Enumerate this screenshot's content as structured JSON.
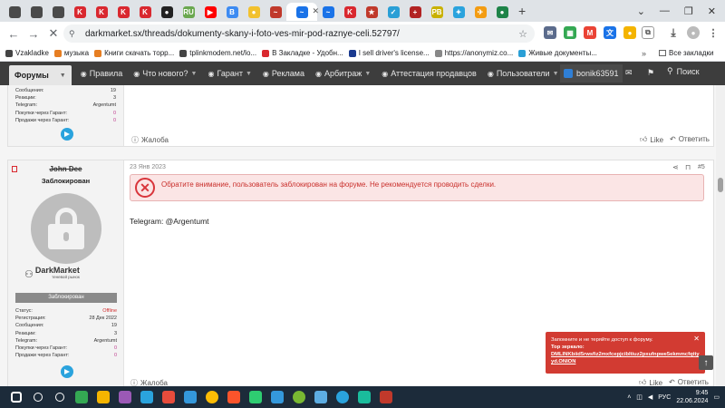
{
  "tabs": [
    {
      "icon": "ring-icon",
      "color": "#4a4a4a",
      "text": ""
    },
    {
      "icon": "ring-icon",
      "color": "#4a4a4a",
      "text": ""
    },
    {
      "icon": "ring-icon",
      "color": "#4a4a4a",
      "text": ""
    },
    {
      "icon": "k-icon",
      "color": "#d9282f",
      "text": "K"
    },
    {
      "icon": "k-icon",
      "color": "#d9282f",
      "text": "K"
    },
    {
      "icon": "k-icon",
      "color": "#d9282f",
      "text": "K"
    },
    {
      "icon": "k-icon",
      "color": "#d9282f",
      "text": "K"
    },
    {
      "icon": "user-icon",
      "color": "#222",
      "text": "●"
    },
    {
      "icon": "ru-icon",
      "color": "#6aa84f",
      "text": "RU"
    },
    {
      "icon": "youtube-icon",
      "color": "#ff0000",
      "text": "▶"
    },
    {
      "icon": "bitcoin-icon",
      "color": "#3d8bf2",
      "text": "B"
    },
    {
      "icon": "coin-icon",
      "color": "#f2c12e",
      "text": "●"
    },
    {
      "icon": "bird-icon",
      "color": "#c0392b",
      "text": "~"
    },
    {
      "icon": "bird-icon",
      "color": "#1a73e8",
      "text": "~"
    },
    {
      "icon": "bird-icon",
      "color": "#1a73e8",
      "text": "~"
    },
    {
      "icon": "k-icon",
      "color": "#d9282f",
      "text": "K"
    },
    {
      "icon": "star-icon",
      "color": "#c0392b",
      "text": "★"
    },
    {
      "icon": "flag-icon",
      "color": "#2a9fd6",
      "text": "✓"
    },
    {
      "icon": "plus-icon",
      "color": "#b22222",
      "text": "+"
    },
    {
      "icon": "pb-icon",
      "color": "#c9b100",
      "text": "PB"
    },
    {
      "icon": "puzzle-icon",
      "color": "#2aa3dd",
      "text": "✦"
    },
    {
      "icon": "plane-icon",
      "color": "#f39c12",
      "text": "✈"
    },
    {
      "icon": "dot-icon",
      "color": "#1e8449",
      "text": "●"
    }
  ],
  "browser": {
    "url": "darkmarket.sx/threads/dokumenty-skany-i-foto-ves-mir-pod-raznye-celi.52797/",
    "bookmarks": [
      {
        "label": "Vzakladke",
        "color": "#444"
      },
      {
        "label": "музыка",
        "color": "#e67e22"
      },
      {
        "label": "Книги скачать торр...",
        "color": "#e67e22"
      },
      {
        "label": "tplinkmodem.net/lo...",
        "color": "#444"
      },
      {
        "label": "В Закладке - Удобн...",
        "color": "#d9282f"
      },
      {
        "label": "I sell driver's license...",
        "color": "#1a3a8f"
      },
      {
        "label": "https://anonymiz.co...",
        "color": "#888"
      },
      {
        "label": "Живые документы...",
        "color": "#2a9fd6"
      }
    ],
    "all_bookmarks": "Все закладки"
  },
  "nav": {
    "forums": "Форумы",
    "items": [
      {
        "label": "Правила",
        "icon": "rules-icon",
        "dropdown": false
      },
      {
        "label": "Что нового?",
        "icon": "news-icon",
        "dropdown": true
      },
      {
        "label": "Гарант",
        "icon": "guarantor-icon",
        "dropdown": true
      },
      {
        "label": "Реклама",
        "icon": "ads-icon",
        "dropdown": false
      },
      {
        "label": "Арбитраж",
        "icon": "arbitrage-icon",
        "dropdown": true
      },
      {
        "label": "Аттестация продавцов",
        "icon": "attest-icon",
        "dropdown": false
      },
      {
        "label": "Пользователи",
        "icon": "users-icon",
        "dropdown": true
      }
    ],
    "username": "bonik63591",
    "search": "Поиск"
  },
  "post1": {
    "stats": [
      {
        "k": "Сообщения:",
        "v": "19",
        "c": ""
      },
      {
        "k": "Реакции:",
        "v": "3",
        "c": ""
      },
      {
        "k": "Telegram:",
        "v": "Argentumt",
        "c": ""
      },
      {
        "k": "Покупки через Гарант:",
        "v": "0",
        "c": "pink"
      },
      {
        "k": "Продажи через Гарант:",
        "v": "0",
        "c": "pink"
      }
    ],
    "complaint": "Жалоба",
    "like": "Like",
    "reply": "Ответить"
  },
  "post2": {
    "username": "John Dee",
    "title": "Заблокирован",
    "brand": "DarkMarket",
    "brand_sub": "теневой рынок",
    "badge": "Заблокирован",
    "date": "23 Янв 2023",
    "number": "#5",
    "alert": "Обратите внимание, пользователь заблокирован на форуме. Не рекомендуется проводить сделки.",
    "body": "Telegram: @Argentumt",
    "stats": [
      {
        "k": "Статус:",
        "v": "Offline",
        "c": "red"
      },
      {
        "k": "Регистрация:",
        "v": "28 Дек 2022",
        "c": ""
      },
      {
        "k": "Сообщения:",
        "v": "19",
        "c": ""
      },
      {
        "k": "Реакции:",
        "v": "3",
        "c": ""
      },
      {
        "k": "Telegram:",
        "v": "Argentumt",
        "c": ""
      },
      {
        "k": "Покупки через Гарант:",
        "v": "0",
        "c": "pink"
      },
      {
        "k": "Продажи через Гарант:",
        "v": "0",
        "c": "pink"
      }
    ],
    "complaint": "Жалоба",
    "like": "Like",
    "reply": "Ответить"
  },
  "toast": {
    "line1": "Запомните и не теряйте доступ к форуму.",
    "line2": "Тор зеркало:",
    "link": "DMLINKbiid5rwsfiz2mxfcepjcibltiuz2pxufnpwe5ekmmcfqttyyd.ONION"
  },
  "taskbar": {
    "apps": [
      {
        "icon": "windows-icon",
        "color": "#ffffff"
      },
      {
        "icon": "search-icon",
        "color": "#ffffff"
      },
      {
        "icon": "settings-icon",
        "color": "#ffffff"
      },
      {
        "icon": "app-icon",
        "color": "#34a853"
      },
      {
        "icon": "files-icon",
        "color": "#f4b400"
      },
      {
        "icon": "app-icon",
        "color": "#9b59b6"
      },
      {
        "icon": "app-icon",
        "color": "#2aa3dd"
      },
      {
        "icon": "app-icon",
        "color": "#e74c3c"
      },
      {
        "icon": "app-icon",
        "color": "#3498db"
      },
      {
        "icon": "chrome-icon",
        "color": "#fbbc05"
      },
      {
        "icon": "brave-icon",
        "color": "#fb542b"
      },
      {
        "icon": "app-icon",
        "color": "#2ecc71"
      },
      {
        "icon": "app-icon",
        "color": "#3498db"
      },
      {
        "icon": "utorrent-icon",
        "color": "#78b832"
      },
      {
        "icon": "app-icon",
        "color": "#5dade2"
      },
      {
        "icon": "telegram-icon",
        "color": "#2aa3dd"
      },
      {
        "icon": "app-icon",
        "color": "#1abc9c"
      },
      {
        "icon": "app-icon",
        "color": "#c0392b"
      }
    ],
    "lang": "РУС",
    "time": "9:45",
    "date": "22.06.2024"
  }
}
